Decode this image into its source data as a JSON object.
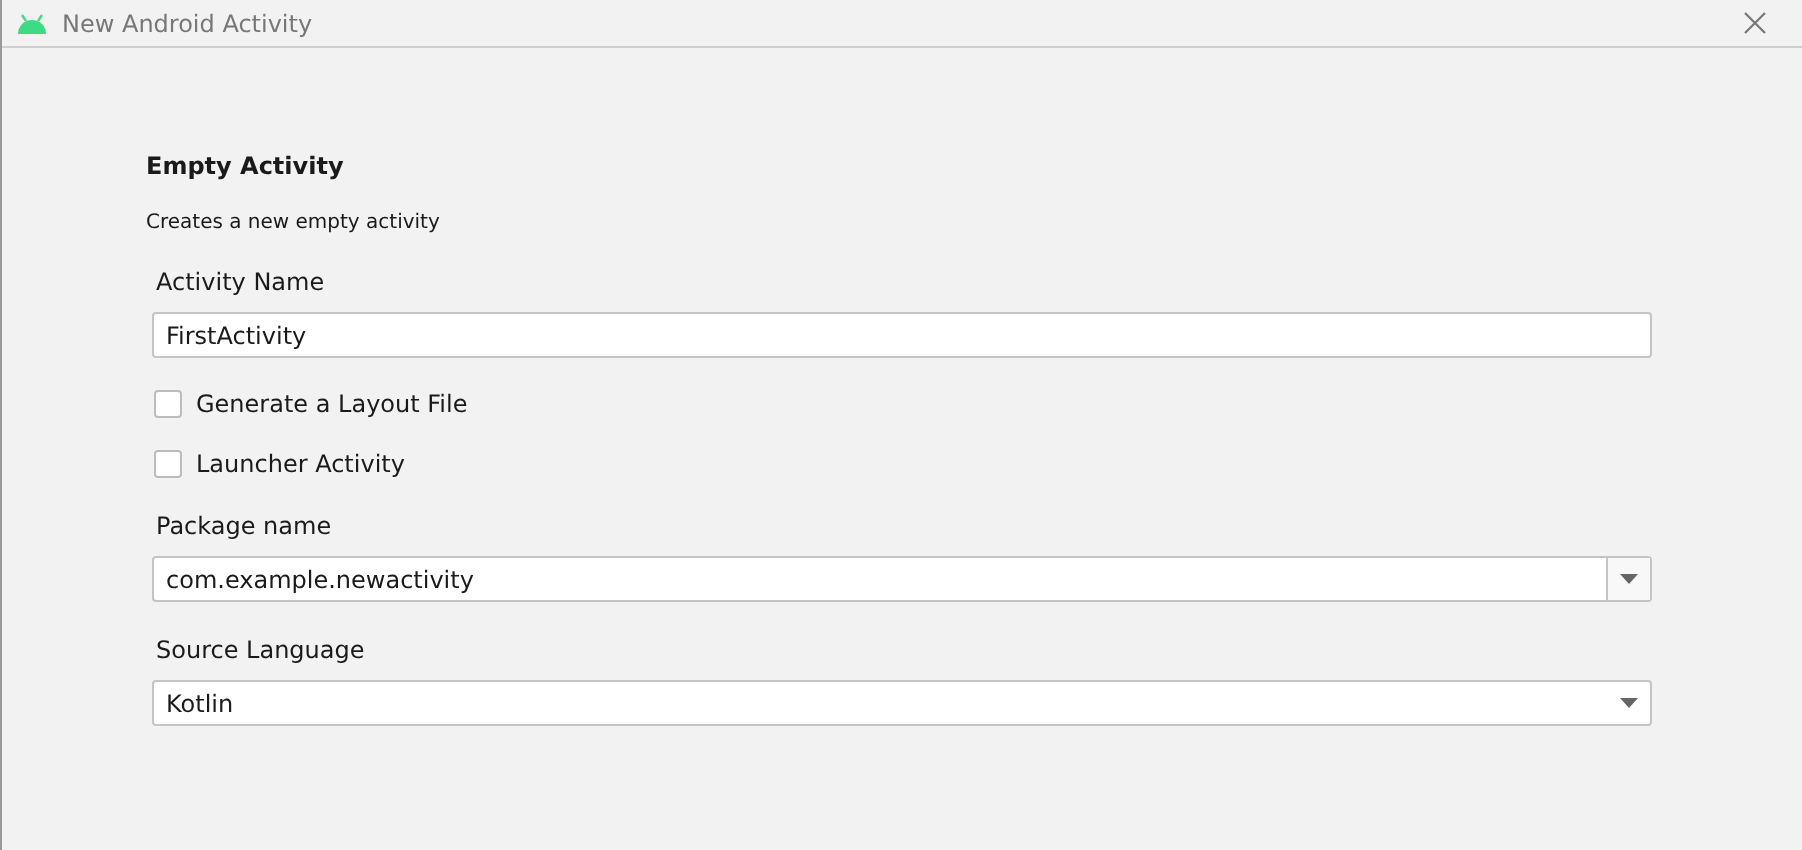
{
  "window": {
    "title": "New Android Activity"
  },
  "heading": "Empty Activity",
  "description": "Creates a new empty activity",
  "fields": [
    {
      "kind": "text",
      "label": "Activity Name",
      "value": "FirstActivity"
    },
    {
      "kind": "checkbox",
      "label": "Generate a Layout File",
      "checked": false
    },
    {
      "kind": "checkbox",
      "label": "Launcher Activity",
      "checked": false
    },
    {
      "kind": "combo",
      "label": "Package name",
      "value": "com.example.newactivity"
    },
    {
      "kind": "dropdown",
      "label": "Source Language",
      "value": "Kotlin"
    }
  ]
}
